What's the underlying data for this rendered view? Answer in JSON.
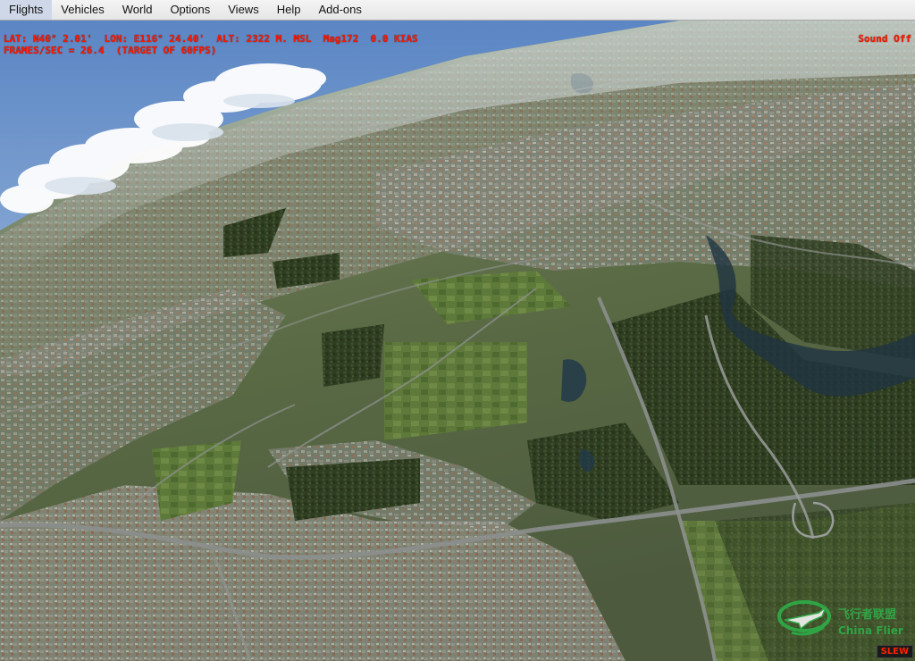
{
  "menu": {
    "items": [
      {
        "label": "Flights"
      },
      {
        "label": "Vehicles"
      },
      {
        "label": "World"
      },
      {
        "label": "Options"
      },
      {
        "label": "Views"
      },
      {
        "label": "Help"
      },
      {
        "label": "Add-ons"
      }
    ]
  },
  "hud": {
    "position_line": "LAT: N40° 2.01'  LON: E116° 24.40'  ALT: 2322 M. MSL  Mag172  0.0 KIAS",
    "frames_line": "FRAMES/SEC = 26.4  (TARGET OF 60FPS)",
    "sound_status": "Sound Off",
    "slew_badge": "SLEW"
  },
  "watermark": {
    "chinese_text": "飞行者联盟",
    "english_text": "China Flier",
    "logo_icon": "airplane-logo-icon"
  },
  "colors": {
    "hud_text": "#ff1a00",
    "menubar_bg": "#ececec",
    "watermark_green": "#2db34a"
  }
}
